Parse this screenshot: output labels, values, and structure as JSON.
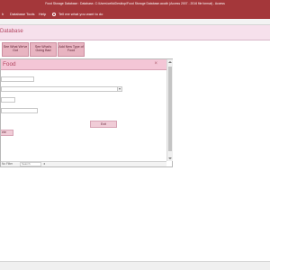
{
  "window": {
    "title": "Food Storage Database : Database- C:\\Users\\cella\\Desktop\\Food Storage Database.accdb (Access 2007 - 2016 file format) - Access"
  },
  "ribbon": {
    "tabs": [
      {
        "label": "h"
      },
      {
        "label": "Database Tools"
      },
      {
        "label": "Help"
      }
    ],
    "tell_me": "Tell me what you want to do"
  },
  "navigation": {
    "title": "Database"
  },
  "switchboard": {
    "buttons": [
      {
        "label": "See What We've Got"
      },
      {
        "label": "See What's Going Bad"
      },
      {
        "label": "Add New Type of Food"
      }
    ]
  },
  "form": {
    "title": "Food",
    "exit_label": "Exit",
    "partial_button_label": "ete",
    "fields": [
      {
        "value": ""
      },
      {
        "value": ""
      },
      {
        "value": ""
      },
      {
        "value": ""
      }
    ],
    "combo": {
      "value": ""
    }
  },
  "status": {
    "record_nav": "No Filter",
    "search_placeholder": "Search"
  },
  "colors": {
    "title_bar": "#a4373a",
    "nav_header": "#f6e0ec",
    "form_header": "#f4c6d6",
    "button": "#e8b4c1",
    "accent_text": "#b2445f"
  }
}
